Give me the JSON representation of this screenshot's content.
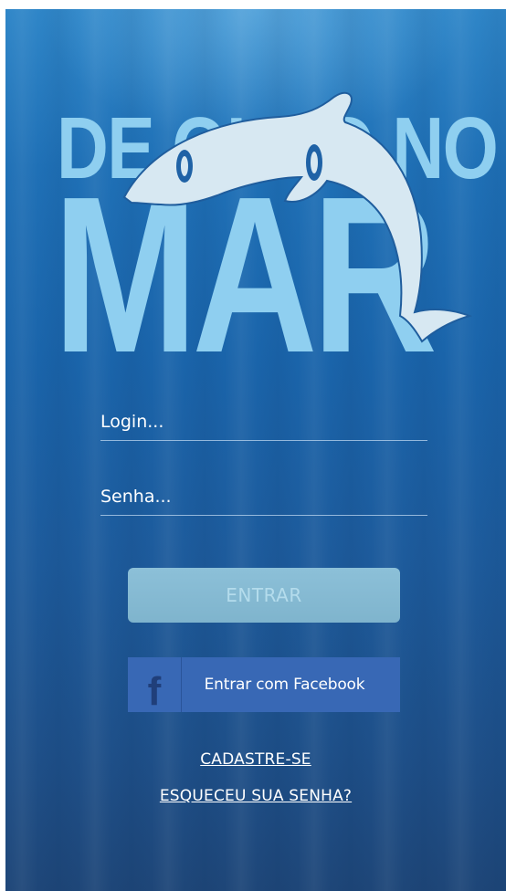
{
  "logo": {
    "line1": "DE OLHO NO",
    "line2": "MAR",
    "icon": "dolphin-icon"
  },
  "login": {
    "placeholder": "Login...",
    "value": ""
  },
  "senha": {
    "placeholder": "Senha...",
    "value": ""
  },
  "buttons": {
    "entrar": "ENTRAR",
    "facebook_label": "Entrar com Facebook",
    "facebook_icon": "facebook-icon",
    "facebook_glyph": "f"
  },
  "links": {
    "cadastre": "CADASTRE-SE",
    "esqueceu": "ESQUECEU SUA SENHA?"
  },
  "colors": {
    "background_top": "#2f86c8",
    "background_bottom": "#1e4678",
    "logo": "#8fcff0",
    "dolphin": "#d7e8f2",
    "entrar_button": "#8cc0d8",
    "facebook_button": "#3868b5"
  }
}
